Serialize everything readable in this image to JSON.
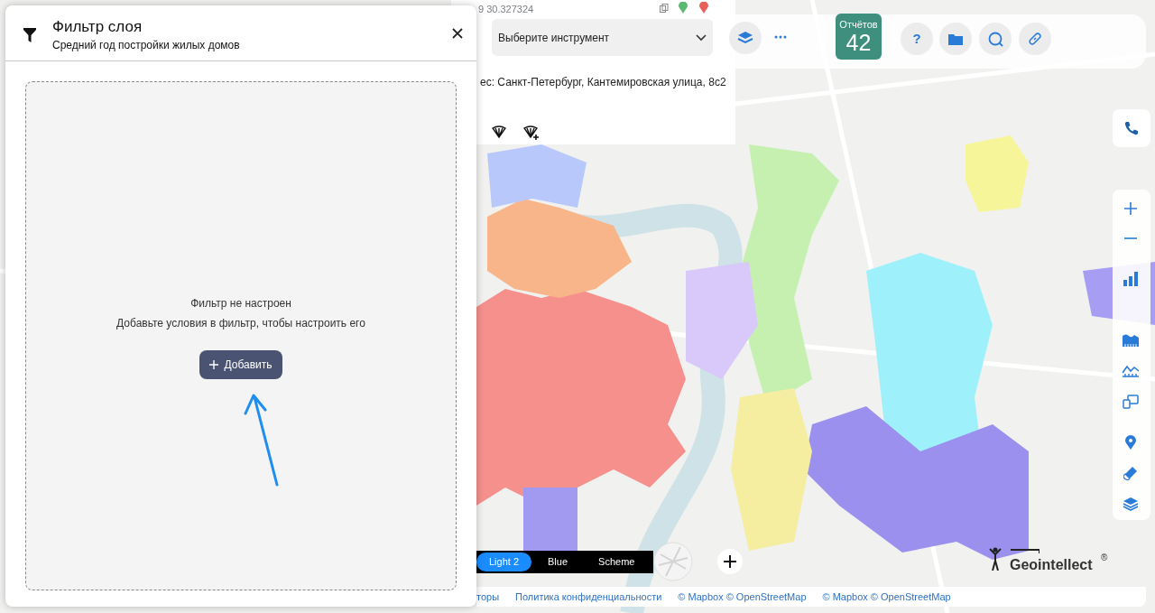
{
  "filter_panel": {
    "title": "Фильтр слоя",
    "subtitle": "Средний год постройки жилых домов",
    "empty_title": "Фильтр не настроен",
    "empty_hint": "Добавьте условия в фильтр, чтобы настроить его",
    "add_button": "Добавить"
  },
  "info_panel": {
    "coordinates": "9 30.327324",
    "address": "ес: Санкт-Петербург, Кантемировская улица, 8с2"
  },
  "toolbar": {
    "tool_select": {
      "value": "Выберите инструмент"
    },
    "reports": {
      "label": "Отчётов",
      "count": "42"
    },
    "help_button": "?"
  },
  "map_styles": [
    {
      "label": "Light 2",
      "selected": true
    },
    {
      "label": "Blue",
      "selected": false
    },
    {
      "label": "Scheme",
      "selected": false
    }
  ],
  "logo": {
    "name": "Geointellect",
    "mark": "®"
  },
  "footer_links": [
    "торы",
    "Политика конфиденциальности",
    "© Mapbox © OpenStreetMap",
    "© Mapbox © OpenStreetMap"
  ]
}
